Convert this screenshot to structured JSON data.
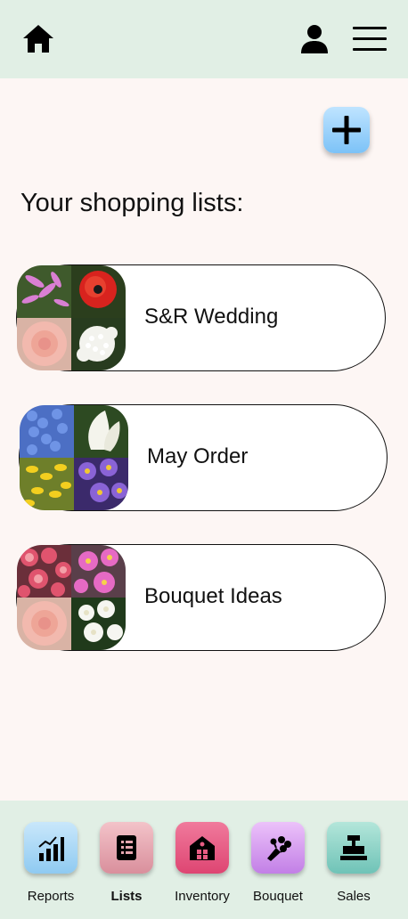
{
  "header": {
    "home_icon": "home-icon",
    "profile_icon": "user-icon",
    "menu_icon": "hamburger-menu-icon"
  },
  "add_button": {
    "icon": "plus-icon",
    "color": "#7cc2f7"
  },
  "page_heading": "Your shopping lists:",
  "lists": [
    {
      "name": "S&R Wedding",
      "thumbnail": "mosaic of nerine, red poppy, pink rose, queen anne's lace"
    },
    {
      "name": "May Order",
      "thumbnail": "mosaic of delphinium, calla lily, forsythia, asters"
    },
    {
      "name": "Bouquet Ideas",
      "thumbnail": "mosaic of zinnias, cosmos, pink rose, white jasmine"
    }
  ],
  "bottom_nav": [
    {
      "label": "Reports",
      "icon": "bar-chart-icon",
      "color": "#a6d6f5",
      "active": false
    },
    {
      "label": "Lists",
      "icon": "list-document-icon",
      "color": "#e6a6b0",
      "active": true
    },
    {
      "label": "Inventory",
      "icon": "barn-icon",
      "color": "#e85c84",
      "active": false
    },
    {
      "label": "Bouquet",
      "icon": "bouquet-icon",
      "color": "#d59cef",
      "active": false
    },
    {
      "label": "Sales",
      "icon": "cash-register-icon",
      "color": "#8fd4c8",
      "active": false
    }
  ]
}
